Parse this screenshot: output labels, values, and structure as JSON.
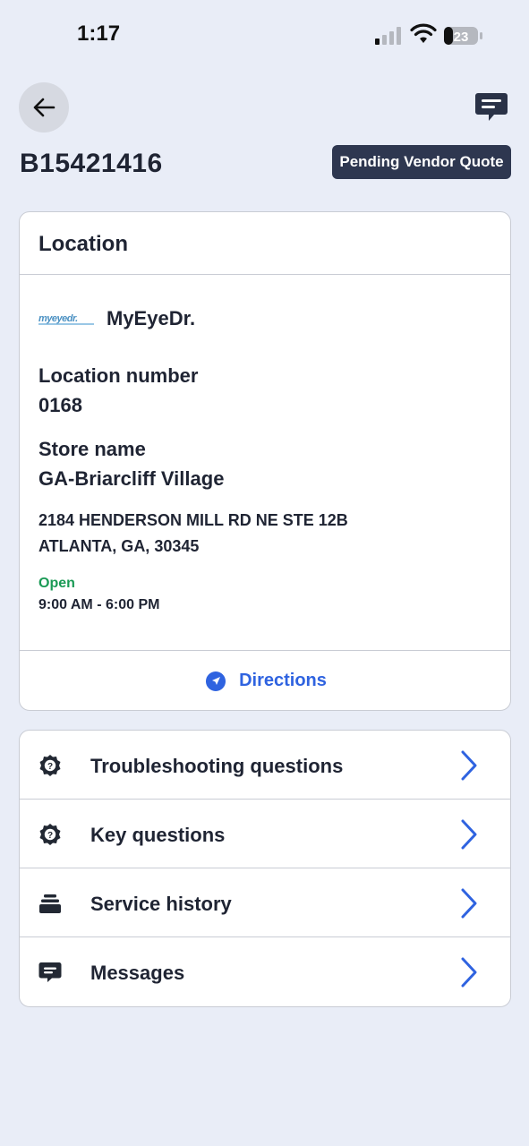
{
  "status_bar": {
    "time": "1:17",
    "battery": "23"
  },
  "header": {
    "ticket_id": "B15421416",
    "status_badge": "Pending Vendor Quote"
  },
  "location": {
    "title": "Location",
    "brand_logo_text": "myeyedr.",
    "brand_name": "MyEyeDr.",
    "location_number_label": "Location number",
    "location_number": "0168",
    "store_name_label": "Store name",
    "store_name": "GA-Briarcliff Village",
    "address_line1": "2184 HENDERSON MILL RD NE STE 12B",
    "address_line2": "ATLANTA, GA, 30345",
    "open_status": "Open",
    "hours": "9:00 AM - 6:00 PM",
    "directions_label": "Directions"
  },
  "menu": [
    {
      "label": "Troubleshooting questions",
      "icon": "gear-question-icon"
    },
    {
      "label": "Key questions",
      "icon": "gear-question-icon"
    },
    {
      "label": "Service history",
      "icon": "stack-icon"
    },
    {
      "label": "Messages",
      "icon": "message-icon"
    }
  ],
  "colors": {
    "background": "#e9edf7",
    "badge": "#2e3750",
    "accent": "#2f63e0",
    "open": "#1a9a55"
  }
}
